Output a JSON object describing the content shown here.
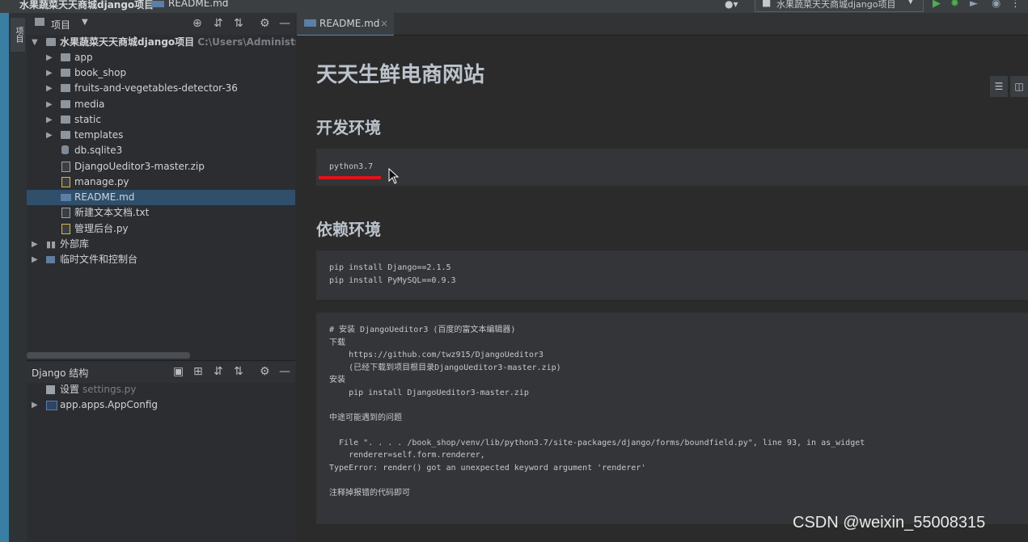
{
  "topbar": {
    "project_crumb": "水果蔬菜天天商城django项目",
    "file_crumb": "README.md",
    "run_config": "水果蔬菜天天商城django项目"
  },
  "toolstrip": {
    "project_tab": "项目"
  },
  "project_panel": {
    "title": "项目",
    "root": {
      "label": "水果蔬菜天天商城django项目",
      "path": "C:\\Users\\Administrator"
    },
    "items": [
      {
        "label": "app",
        "kind": "folder"
      },
      {
        "label": "book_shop",
        "kind": "folder"
      },
      {
        "label": "fruits-and-vegetables-detector-36",
        "kind": "folder"
      },
      {
        "label": "media",
        "kind": "folder"
      },
      {
        "label": "static",
        "kind": "folder"
      },
      {
        "label": "templates",
        "kind": "folder"
      },
      {
        "label": "db.sqlite3",
        "kind": "db"
      },
      {
        "label": "DjangoUeditor3-master.zip",
        "kind": "zip"
      },
      {
        "label": "manage.py",
        "kind": "python"
      },
      {
        "label": "README.md",
        "kind": "markdown"
      },
      {
        "label": "新建文本文档.txt",
        "kind": "text"
      },
      {
        "label": "管理后台.py",
        "kind": "python"
      }
    ],
    "external_libs": "外部库",
    "scratches": "临时文件和控制台"
  },
  "structure_panel": {
    "title": "Django 结构",
    "settings_label": "设置",
    "settings_file": "settings.py",
    "app_config": "app.apps.AppConfig"
  },
  "editor": {
    "tab_label": "README.md",
    "h1": "天天生鲜电商网站",
    "h2_env": "开发环境",
    "code_env": "python3.7",
    "h2_deps": "依赖环境",
    "code_deps": "pip install Django==2.1.5\npip install PyMySQL==0.9.3",
    "code_notes": "# 安装 DjangoUeditor3 (百度的富文本编辑器)\n下载\n    https://github.com/twz915/DjangoUeditor3\n    (已经下载到项目根目录DjangoUeditor3-master.zip)\n安装\n    pip install DjangoUeditor3-master.zip\n\n中途可能遇到的问题\n\n  File \". . . . /book_shop/venv/lib/python3.7/site-packages/django/forms/boundfield.py\", line 93, in as_widget\n    renderer=self.form.renderer,\nTypeError: render() got an unexpected keyword argument 'renderer'\n\n注释掉报错的代码即可"
  },
  "watermark": "CSDN @weixin_55008315",
  "colors": {
    "accent": "#4a88c7",
    "underline": "#e0121b",
    "selection": "#2f4f6b"
  }
}
